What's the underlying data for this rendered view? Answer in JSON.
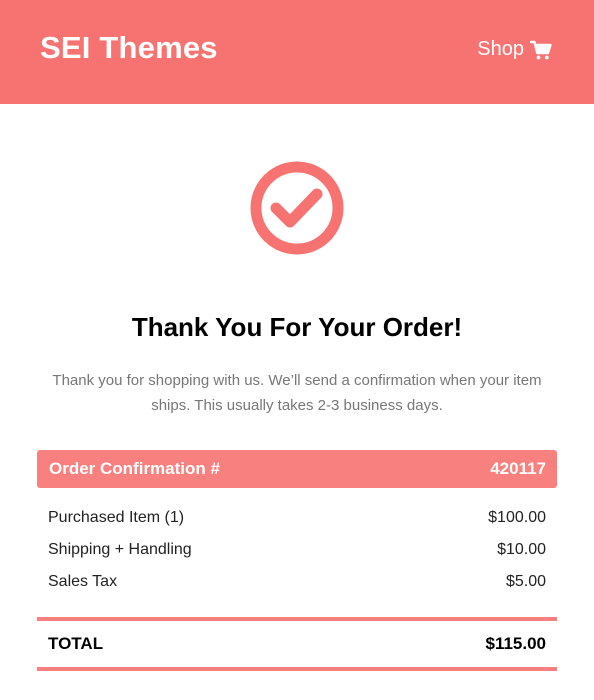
{
  "header": {
    "brand": "SEI Themes",
    "shop_label": "Shop",
    "shop_icon": "cart-icon",
    "background": "#f67372"
  },
  "confirmation": {
    "icon": "checkmark-circle-icon",
    "title": "Thank You For Your Order!",
    "message": "Thank you for shopping with us. We’ll send a confirmation when your item ships. This usually takes 2-3 business days."
  },
  "order": {
    "label": "Order Confirmation #",
    "number": "420117",
    "accent": "#f8807e",
    "items": [
      {
        "name": "Purchased Item (1)",
        "amount": "$100.00"
      },
      {
        "name": "Shipping + Handling",
        "amount": "$10.00"
      },
      {
        "name": "Sales Tax",
        "amount": "$5.00"
      }
    ],
    "total_label": "TOTAL",
    "total_amount": "$115.00"
  }
}
